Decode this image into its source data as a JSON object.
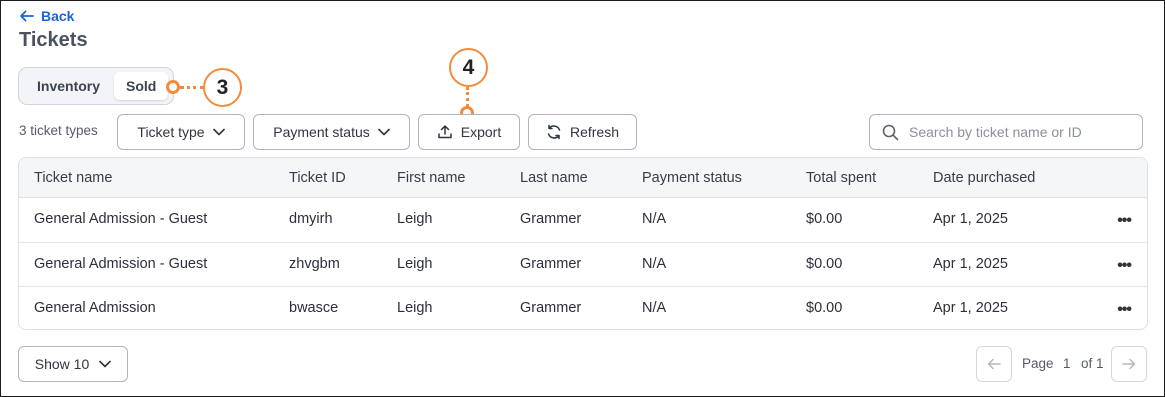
{
  "header": {
    "back_label": "Back",
    "title": "Tickets"
  },
  "segmented": {
    "options": [
      "Inventory",
      "Sold"
    ],
    "selected": "Sold"
  },
  "callouts": {
    "c3": "3",
    "c4": "4"
  },
  "toolbar": {
    "count_label": "3 ticket types",
    "ticket_type_label": "Ticket type",
    "payment_status_label": "Payment status",
    "export_label": "Export",
    "refresh_label": "Refresh",
    "search_placeholder": "Search by ticket name or ID"
  },
  "table": {
    "columns": [
      "Ticket name",
      "Ticket ID",
      "First name",
      "Last name",
      "Payment status",
      "Total spent",
      "Date purchased"
    ],
    "rows": [
      [
        "General Admission - Guest",
        "dmyirh",
        "Leigh",
        "Grammer",
        "N/A",
        "$0.00",
        "Apr 1, 2025"
      ],
      [
        "General Admission - Guest",
        "zhvgbm",
        "Leigh",
        "Grammer",
        "N/A",
        "$0.00",
        "Apr 1, 2025"
      ],
      [
        "General Admission",
        "bwasce",
        "Leigh",
        "Grammer",
        "N/A",
        "$0.00",
        "Apr 1, 2025"
      ]
    ],
    "row_menu_glyph": "•••"
  },
  "footer": {
    "show_label": "Show 10",
    "page_label": "Page",
    "page_current": "1",
    "page_of": "of 1"
  },
  "colors": {
    "accent": "#1a63d8",
    "callout": "#f28b3c"
  }
}
